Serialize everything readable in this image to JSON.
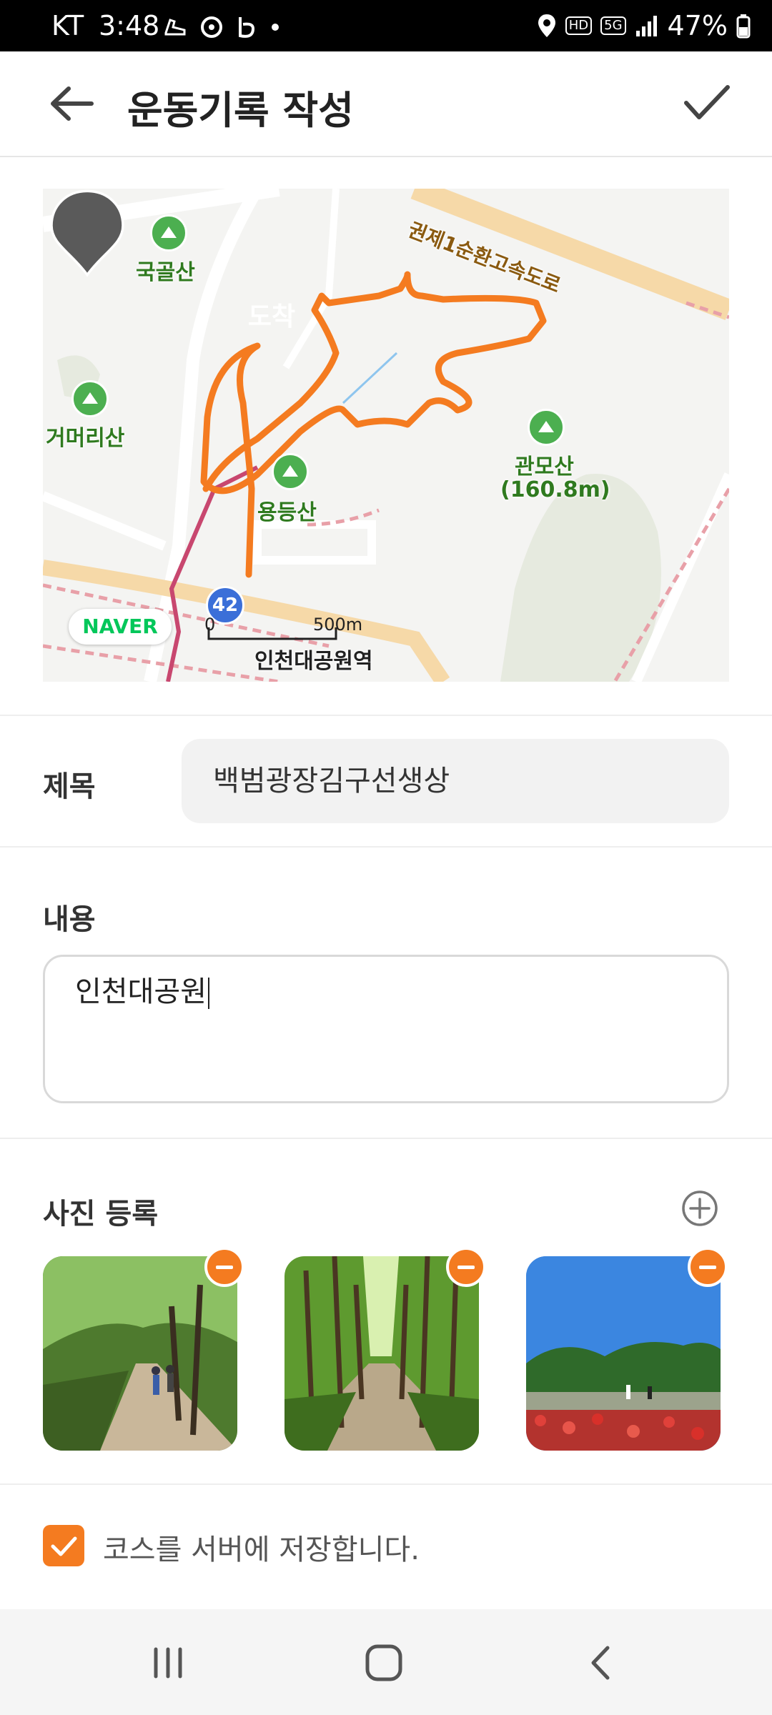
{
  "status_bar": {
    "carrier": "KT",
    "time": "3:48",
    "hd_badge": "HD",
    "network": "5G",
    "battery": "47%"
  },
  "app_bar": {
    "title": "운동기록 작성",
    "back_icon": "arrow-left-icon",
    "confirm_icon": "check-icon"
  },
  "map": {
    "labels": {
      "gukgolsan": "국골산",
      "geomeorisan": "거머리산",
      "yongdeungsan": "용등산",
      "gwanmosan": "관모산",
      "gwanmosan_height": "(160.8m)",
      "station": "인천대공원역",
      "expressway": "권제1순환고속도로"
    },
    "arrival_marker": "도착",
    "route_number": "42",
    "scale_start": "0",
    "scale_end": "500m",
    "provider": "NAVER",
    "route_color": "#f47b20"
  },
  "form": {
    "title_label": "제목",
    "title_value": "백범광장김구선생상",
    "content_label": "내용",
    "content_value": "인천대공원"
  },
  "photos": {
    "section_label": "사진 등록",
    "add_icon": "plus-circle-icon",
    "remove_icon": "minus-circle-icon",
    "count": 3
  },
  "save_course": {
    "checked": true,
    "label": "코스를 서버에 저장합니다."
  },
  "nav_bar": {
    "recent_icon": "recent-apps-icon",
    "home_icon": "home-icon",
    "back_icon": "nav-back-icon"
  },
  "colors": {
    "accent": "#f47b20",
    "input_bg": "#f2f2f2"
  }
}
